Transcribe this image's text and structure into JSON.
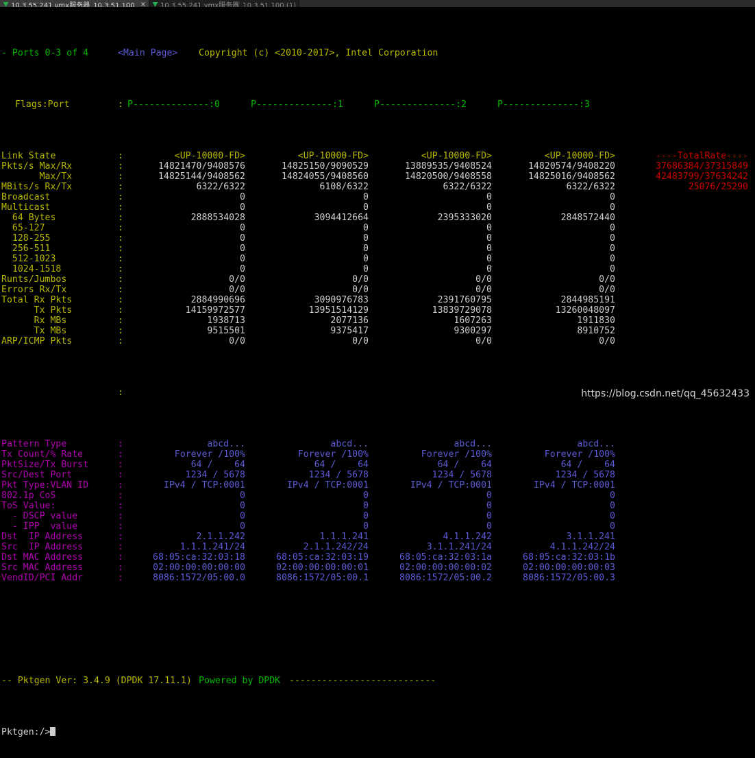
{
  "window": {
    "tabs": [
      {
        "title": "10.3.55.241 vmx服务器_10.3.51.100",
        "active": true,
        "close_label": "×",
        "icon": "vm-green-icon"
      },
      {
        "title": "10.3.55.241 vmx服务器_10.3.51.100 (1)",
        "active": false,
        "close_label": "",
        "icon": "vm-green-icon"
      }
    ]
  },
  "header": {
    "ports_label": "- Ports 0-3 of 4",
    "page_label": "<Main Page>",
    "copyright": "Copyright (c) <2010-2017>, Intel Corporation"
  },
  "columns": {
    "headers": [
      "P--------------:0",
      "P--------------:1",
      "P--------------:2",
      "P--------------:3"
    ],
    "flags_port_label": "Flags:Port",
    "totalrate_header": "----TotalRate----"
  },
  "stats": {
    "labels": [
      "Link State",
      "Pkts/s Max/Rx",
      "       Max/Tx",
      "MBits/s Rx/Tx",
      "Broadcast",
      "Multicast",
      "  64 Bytes",
      "  65-127",
      "  128-255",
      "  256-511",
      "  512-1023",
      "  1024-1518",
      "Runts/Jumbos",
      "Errors Rx/Tx",
      "Total Rx Pkts",
      "      Tx Pkts",
      "      Rx MBs",
      "      Tx MBs",
      "ARP/ICMP Pkts"
    ],
    "rows": [
      {
        "label": "Link State",
        "values": [
          "<UP-10000-FD>",
          "<UP-10000-FD>",
          "<UP-10000-FD>",
          "<UP-10000-FD>"
        ],
        "total": "",
        "style": "linkstate"
      },
      {
        "label": "Pkts/s Max/Rx",
        "values": [
          "14821470/9408576",
          "14825150/9090529",
          "13889535/9408524",
          "14820574/9408220"
        ],
        "total": "37686384/37315849",
        "style": "num"
      },
      {
        "label": "       Max/Tx",
        "values": [
          "14825144/9408562",
          "14824055/9408560",
          "14820500/9408558",
          "14825016/9408562"
        ],
        "total": "42483799/37634242",
        "style": "num"
      },
      {
        "label": "MBits/s Rx/Tx",
        "values": [
          "6322/6322",
          "6108/6322",
          "6322/6322",
          "6322/6322"
        ],
        "total": "25076/25290",
        "style": "num"
      },
      {
        "label": "Broadcast",
        "values": [
          "0",
          "0",
          "0",
          "0"
        ],
        "total": "",
        "style": "num"
      },
      {
        "label": "Multicast",
        "values": [
          "0",
          "0",
          "0",
          "0"
        ],
        "total": "",
        "style": "num"
      },
      {
        "label": "  64 Bytes",
        "values": [
          "2888534028",
          "3094412664",
          "2395333020",
          "2848572440"
        ],
        "total": "",
        "style": "num"
      },
      {
        "label": "  65-127",
        "values": [
          "0",
          "0",
          "0",
          "0"
        ],
        "total": "",
        "style": "num"
      },
      {
        "label": "  128-255",
        "values": [
          "0",
          "0",
          "0",
          "0"
        ],
        "total": "",
        "style": "num"
      },
      {
        "label": "  256-511",
        "values": [
          "0",
          "0",
          "0",
          "0"
        ],
        "total": "",
        "style": "num"
      },
      {
        "label": "  512-1023",
        "values": [
          "0",
          "0",
          "0",
          "0"
        ],
        "total": "",
        "style": "num"
      },
      {
        "label": "  1024-1518",
        "values": [
          "0",
          "0",
          "0",
          "0"
        ],
        "total": "",
        "style": "num"
      },
      {
        "label": "Runts/Jumbos",
        "values": [
          "0/0",
          "0/0",
          "0/0",
          "0/0"
        ],
        "total": "",
        "style": "num"
      },
      {
        "label": "Errors Rx/Tx",
        "values": [
          "0/0",
          "0/0",
          "0/0",
          "0/0"
        ],
        "total": "",
        "style": "num"
      },
      {
        "label": "Total Rx Pkts",
        "values": [
          "2884990696",
          "3090976783",
          "2391760795",
          "2844985191"
        ],
        "total": "",
        "style": "num"
      },
      {
        "label": "      Tx Pkts",
        "values": [
          "14159972577",
          "13951514129",
          "13839729078",
          "13260048097"
        ],
        "total": "",
        "style": "num"
      },
      {
        "label": "      Rx MBs",
        "values": [
          "1938713",
          "2077136",
          "1607263",
          "1911830"
        ],
        "total": "",
        "style": "num"
      },
      {
        "label": "      Tx MBs",
        "values": [
          "9515501",
          "9375417",
          "9300297",
          "8910752"
        ],
        "total": "",
        "style": "num"
      },
      {
        "label": "ARP/ICMP Pkts",
        "values": [
          "0/0",
          "0/0",
          "0/0",
          "0/0"
        ],
        "total": "",
        "style": "num"
      }
    ]
  },
  "config": {
    "rows": [
      {
        "label": "Pattern Type",
        "values": [
          "abcd...",
          "abcd...",
          "abcd...",
          "abcd..."
        ]
      },
      {
        "label": "Tx Count/% Rate",
        "values": [
          "Forever /100%",
          "Forever /100%",
          "Forever /100%",
          "Forever /100%"
        ]
      },
      {
        "label": "PktSize/Tx Burst",
        "values": [
          "64 /    64",
          "64 /    64",
          "64 /    64",
          "64 /    64"
        ]
      },
      {
        "label": "Src/Dest Port",
        "values": [
          "1234 / 5678",
          "1234 / 5678",
          "1234 / 5678",
          "1234 / 5678"
        ]
      },
      {
        "label": "Pkt Type:VLAN ID",
        "values": [
          "IPv4 / TCP:0001",
          "IPv4 / TCP:0001",
          "IPv4 / TCP:0001",
          "IPv4 / TCP:0001"
        ]
      },
      {
        "label": "802.1p CoS",
        "values": [
          "0",
          "0",
          "0",
          "0"
        ]
      },
      {
        "label": "ToS Value:",
        "values": [
          "0",
          "0",
          "0",
          "0"
        ]
      },
      {
        "label": "  - DSCP value",
        "values": [
          "0",
          "0",
          "0",
          "0"
        ]
      },
      {
        "label": "  - IPP  value",
        "values": [
          "0",
          "0",
          "0",
          "0"
        ]
      },
      {
        "label": "Dst  IP Address",
        "values": [
          "2.1.1.242",
          "1.1.1.241",
          "4.1.1.242",
          "3.1.1.241"
        ]
      },
      {
        "label": "Src  IP Address",
        "values": [
          "1.1.1.241/24",
          "2.1.1.242/24",
          "3.1.1.241/24",
          "4.1.1.242/24"
        ]
      },
      {
        "label": "Dst MAC Address",
        "values": [
          "68:05:ca:32:03:18",
          "68:05:ca:32:03:19",
          "68:05:ca:32:03:1a",
          "68:05:ca:32:03:1b"
        ]
      },
      {
        "label": "Src MAC Address",
        "values": [
          "02:00:00:00:00:00",
          "02:00:00:00:00:01",
          "02:00:00:00:00:02",
          "02:00:00:00:00:03"
        ]
      },
      {
        "label": "VendID/PCI Addr",
        "values": [
          "8086:1572/05:00.0",
          "8086:1572/05:00.1",
          "8086:1572/05:00.2",
          "8086:1572/05:00.3"
        ]
      }
    ]
  },
  "footer": {
    "version_text": "-- Pktgen Ver: 3.4.9 (DPDK 17.11.1)",
    "powered_text": "Powered by DPDK",
    "rule": "---------------------------",
    "prompt": "Pktgen:/>"
  },
  "watermark": "https://blog.csdn.net/qq_45632433",
  "colors": {
    "background": "#000000",
    "label": "#b9b900",
    "value": "#cfcfcf",
    "linkstate": "#b9b900",
    "config_label": "#b000b0",
    "config_value": "#5b5bd6",
    "total": "#cc0000",
    "page": "#5b5bd6",
    "ports": "#00bb00"
  }
}
